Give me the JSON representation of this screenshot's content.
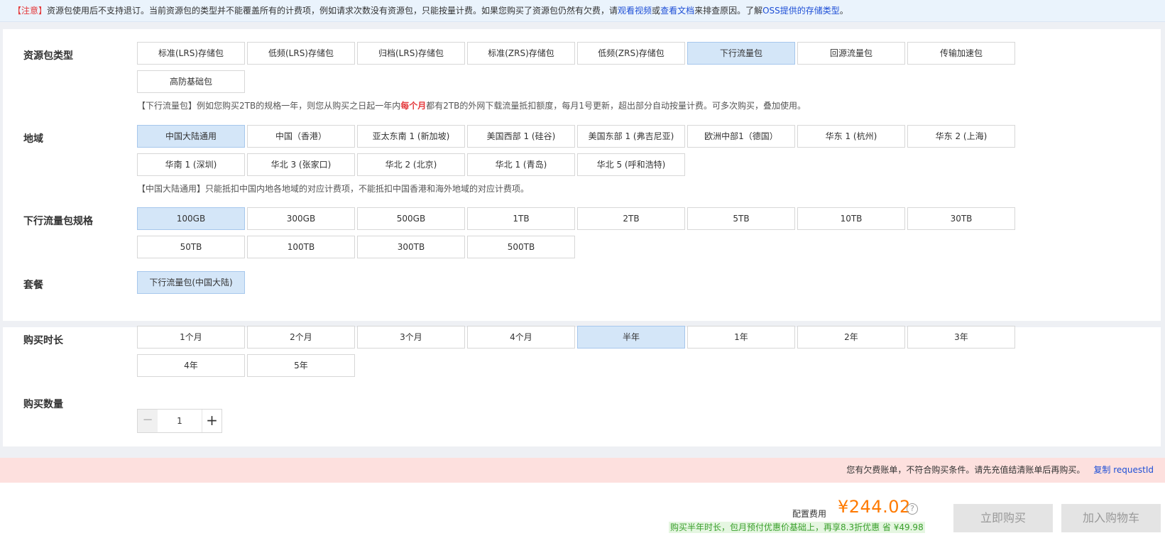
{
  "notice": {
    "tag": "【注意】",
    "text1": "资源包使用后不支持退订。当前资源包的类型并不能覆盖所有的计费项，例如请求次数没有资源包，只能按量计费。如果您购买了资源包仍然有欠费，请",
    "link_video": "观看视频",
    "or": "或",
    "link_docs": "查看文档",
    "text2": "来排查原因。了解",
    "link_types": "OSS提供的存储类型",
    "end": "。"
  },
  "package_type": {
    "label": "资源包类型",
    "options": [
      "标准(LRS)存储包",
      "低频(LRS)存储包",
      "归档(LRS)存储包",
      "标准(ZRS)存储包",
      "低频(ZRS)存储包",
      "下行流量包",
      "回源流量包",
      "传输加速包",
      "高防基础包"
    ],
    "selected_index": 5,
    "hint_pre": "【下行流量包】例如您购买2TB的规格一年，则您从购买之日起一年内",
    "hint_red": "每个月",
    "hint_post": "都有2TB的外网下载流量抵扣额度，每月1号更新，超出部分自动按量计费。可多次购买，叠加使用。"
  },
  "region": {
    "label": "地域",
    "options": [
      "中国大陆通用",
      "中国（香港）",
      "亚太东南 1 (新加坡)",
      "美国西部 1 (硅谷)",
      "美国东部 1 (弗吉尼亚)",
      "欧洲中部1（德国）",
      "华东 1 (杭州)",
      "华东 2 (上海)",
      "华南 1 (深圳)",
      "华北 3 (张家口)",
      "华北 2 (北京)",
      "华北 1 (青岛)",
      "华北 5 (呼和浩特)"
    ],
    "selected_index": 0,
    "hint": "【中国大陆通用】只能抵扣中国内地各地域的对应计费项，不能抵扣中国香港和海外地域的对应计费项。"
  },
  "spec": {
    "label": "下行流量包规格",
    "options": [
      "100GB",
      "300GB",
      "500GB",
      "1TB",
      "2TB",
      "5TB",
      "10TB",
      "30TB",
      "50TB",
      "100TB",
      "300TB",
      "500TB"
    ],
    "selected_index": 0
  },
  "plan": {
    "label": "套餐",
    "options": [
      "下行流量包(中国大陆)"
    ],
    "selected_index": 0
  },
  "duration": {
    "label": "购买时长",
    "options": [
      "1个月",
      "2个月",
      "3个月",
      "4个月",
      "半年",
      "1年",
      "2年",
      "3年",
      "4年",
      "5年"
    ],
    "selected_index": 4
  },
  "quantity": {
    "label": "购买数量",
    "value": "1",
    "minus": "−",
    "plus": "+"
  },
  "alert": {
    "text": "您有欠费账单，不符合购买条件。请先充值结清账单后再购买。",
    "copy_link": "复制 requestId"
  },
  "footer": {
    "fee_label": "配置费用",
    "price": "¥244.02",
    "help": "?",
    "discount": "购买半年时长，包月预付优惠价基础上，再享8.3折优惠 省 ¥49.98",
    "buy_button": "立即购买",
    "cart_button": "加入购物车"
  },
  "colors": {
    "selected_bg": "#d4e6f8",
    "price": "#ff7a00",
    "link": "#1e4fd6",
    "warning": "#e4393c",
    "alert_bg": "#fde0de"
  }
}
